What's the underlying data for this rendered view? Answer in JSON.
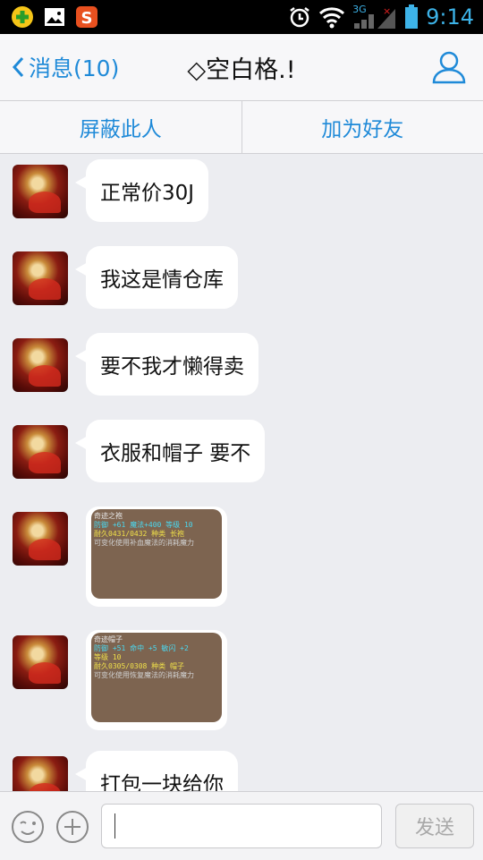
{
  "statusbar": {
    "time": "9:14",
    "network_label": "3G",
    "icons": [
      "app-plus-icon",
      "gallery-icon",
      "sogou-input-icon",
      "alarm-icon",
      "wifi-icon",
      "signal-icon",
      "battery-icon"
    ]
  },
  "header": {
    "back_label": "消息(10)",
    "title": "◇空白格.!",
    "profile_icon": "person-icon"
  },
  "actions": {
    "block_label": "屏蔽此人",
    "add_friend_label": "加为好友"
  },
  "messages": [
    {
      "type": "text",
      "text": "正常价30J"
    },
    {
      "type": "text",
      "text": "我这是情仓库"
    },
    {
      "type": "text",
      "text": "要不我才懒得卖"
    },
    {
      "type": "text",
      "text": "衣服和帽子 要不"
    },
    {
      "type": "image",
      "lines": [
        "奇迹之袍",
        "防御 +61 魔法+400 等级 10",
        "耐久0431/0432 种类 长袍",
        "可变化使用补血魔法的消耗魔力"
      ]
    },
    {
      "type": "image",
      "lines": [
        "奇迹帽子",
        "防御 +51 命中 +5 敏闪 +2",
        "等级 10",
        "耐久0305/0308 种类 帽子",
        "可变化使用恢复魔法的消耗魔力"
      ]
    },
    {
      "type": "text",
      "text": "打包一块给你"
    }
  ],
  "input": {
    "value": "",
    "placeholder": "",
    "send_label": "发送"
  },
  "colors": {
    "accent": "#1f8ad8",
    "background": "#ecedf1",
    "statusbar": "#000000"
  }
}
